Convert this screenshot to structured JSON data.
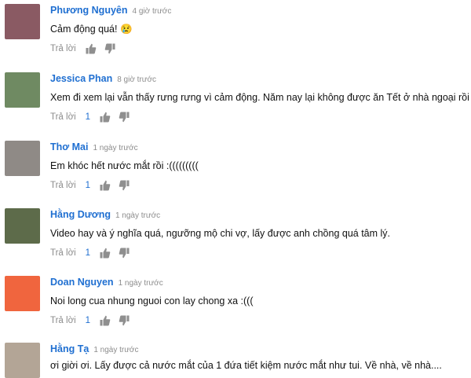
{
  "comments": [
    {
      "author": "Phương Nguyên",
      "time": "4 giờ trước",
      "text": "Cảm động quá! 😢",
      "reply_label": "Trả lời",
      "likes": "",
      "avatar_color": "#8a5a63"
    },
    {
      "author": "Jessica Phan",
      "time": "8 giờ trước",
      "text": "Xem đi xem lại vẫn thấy rưng rưng vì cảm động. Năm nay lại không được ăn Tết ở nhà ngoại rồi :(",
      "reply_label": "Trả lời",
      "likes": "1",
      "avatar_color": "#6f8a62"
    },
    {
      "author": "Thơ Mai",
      "time": "1 ngày trước",
      "text": "Em khóc hết nước mắt rồi :(((((((((",
      "reply_label": "Trả lời",
      "likes": "1",
      "avatar_color": "#8f8a86"
    },
    {
      "author": "Hằng Dương",
      "time": "1 ngày trước",
      "text": "Video hay và ý nghĩa quá, ngưỡng mộ chi vợ, lấy được anh chồng quá tâm lý.",
      "reply_label": "Trả lời",
      "likes": "1",
      "avatar_color": "#5d6b4a"
    },
    {
      "author": "Doan Nguyen",
      "time": "1 ngày trước",
      "text": "Noi long cua nhung nguoi con lay chong xa :(((",
      "reply_label": "Trả lời",
      "likes": "1",
      "avatar_color": "#f0653e"
    },
    {
      "author": "Hằng Tạ",
      "time": "1 ngày trước",
      "text": "ơi giời ơi. Lấy được cả nước mắt của 1 đứa tiết kiệm nước mắt như tui. Về nhà, về nhà....",
      "reply_label": "Trả lời",
      "likes": "",
      "avatar_color": "#b3a596"
    }
  ],
  "icons": {
    "like": "thumbs-up-icon",
    "dislike": "thumbs-down-icon"
  },
  "colors": {
    "author": "#1f6fd1",
    "meta": "#8c8c8c",
    "icon": "#8f8f8f"
  }
}
